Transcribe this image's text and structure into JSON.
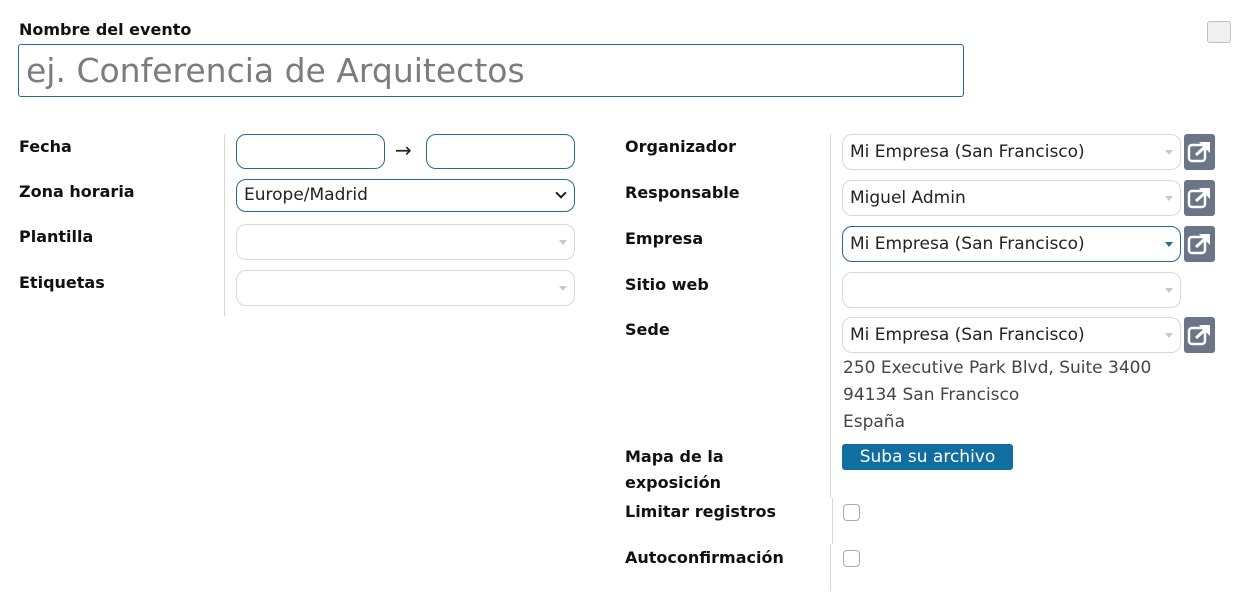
{
  "event_name": {
    "label": "Nombre del evento",
    "placeholder": "ej. Conferencia de Arquitectos"
  },
  "left_form": {
    "date_label": "Fecha",
    "date_arrow": "→",
    "timezone_label": "Zona horaria",
    "timezone_value": "Europe/Madrid",
    "template_label": "Plantilla",
    "tags_label": "Etiquetas"
  },
  "right_form": {
    "organizer_label": "Organizador",
    "organizer_value": "Mi Empresa (San Francisco)",
    "responsible_label": "Responsable",
    "responsible_value": "Miguel Admin",
    "company_label": "Empresa",
    "company_value": "Mi Empresa (San Francisco)",
    "website_label": "Sitio web",
    "venue_label": "Sede",
    "venue_value": "Mi Empresa (San Francisco)",
    "venue_address": {
      "line1": "250 Executive Park Blvd, Suite 3400",
      "line2": "94134 San Francisco",
      "line3": "España"
    },
    "map_label_line1": "Mapa de la",
    "map_label_line2": "exposición",
    "upload_button": "Suba su archivo",
    "limit_label": "Limitar registros",
    "autoconfirm_label": "Autoconfirmación"
  },
  "colors": {
    "accent": "#1f6f8b",
    "upload_button_bg": "#106ea0",
    "external_button_bg": "#6b7587"
  },
  "icons": {
    "external_link": "external-link-icon",
    "dropdown": "caret-down-icon",
    "date_arrow": "arrow-right-icon"
  }
}
